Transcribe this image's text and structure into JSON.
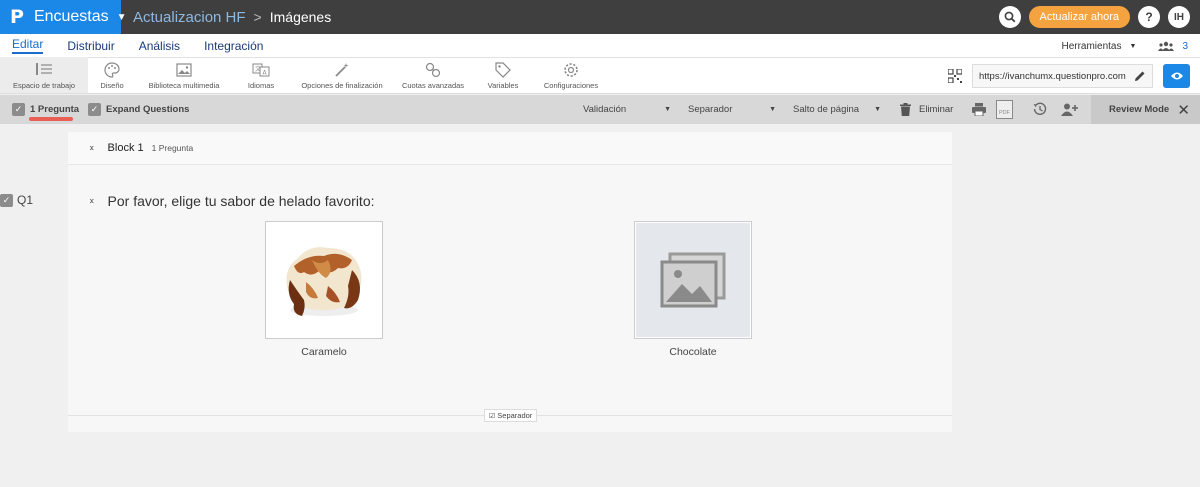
{
  "brand": {
    "logo": "P",
    "name": "Encuestas"
  },
  "breadcrumb": {
    "project": "Actualizacion HF",
    "separator": ">",
    "page": "Imágenes"
  },
  "topbar": {
    "update_label": "Actualizar ahora",
    "help_label": "?",
    "avatar_initials": "IH"
  },
  "nav": {
    "tabs": [
      {
        "label": "Editar",
        "active": true
      },
      {
        "label": "Distribuir"
      },
      {
        "label": "Análisis"
      },
      {
        "label": "Integración"
      }
    ],
    "tools_label": "Herramientas",
    "collaborators_count": "3"
  },
  "toolbar": {
    "items": [
      {
        "label": "Espacio de trabajo",
        "icon": "workspace-icon",
        "active": true
      },
      {
        "label": "Diseño",
        "icon": "palette-icon"
      },
      {
        "label": "Biblioteca multimedia",
        "icon": "image-icon"
      },
      {
        "label": "Idiomas",
        "icon": "translate-icon"
      },
      {
        "label": "Opciones de finalización",
        "icon": "magic-wand-icon"
      },
      {
        "label": "Cuotas avanzadas",
        "icon": "quota-icon"
      },
      {
        "label": "Variables",
        "icon": "tag-icon"
      },
      {
        "label": "Configuraciones",
        "icon": "gear-icon"
      }
    ],
    "url": "https://ivanchumx.questionpro.com"
  },
  "actionbar": {
    "selected_label": "1 Pregunta",
    "expand_label": "Expand Questions",
    "validation_label": "Validación",
    "separator_label": "Separador",
    "page_break_label": "Salto de página",
    "delete_label": "Eliminar",
    "pdf_label": "PDF",
    "review_label": "Review Mode"
  },
  "block": {
    "title": "Block 1",
    "subtitle": "1 Pregunta"
  },
  "question": {
    "number": "Q1",
    "text": "Por favor, elige tu sabor de helado favorito:",
    "options": [
      {
        "label": "Caramelo",
        "image": "ice-cream-photo"
      },
      {
        "label": "Chocolate",
        "image": "image-placeholder"
      }
    ]
  },
  "separator_tag": "Separador",
  "colors": {
    "brand": "#1b87e6",
    "topbar": "#3f3f3f",
    "update": "#f4a340",
    "highlight": "#e95f55"
  }
}
